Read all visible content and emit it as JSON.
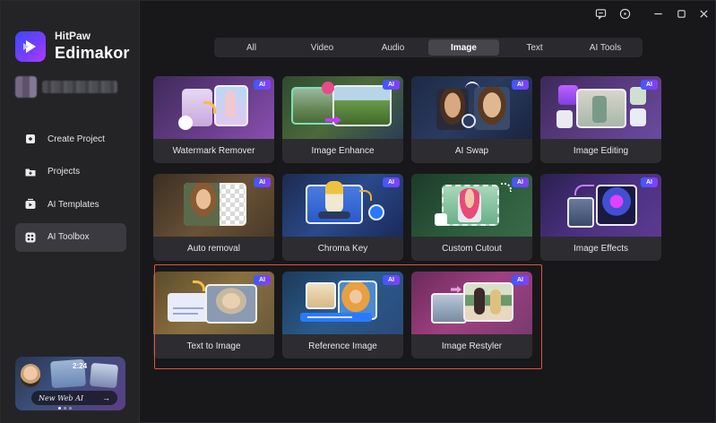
{
  "brand": {
    "company": "HitPaw",
    "product": "Edimakor"
  },
  "sidebar": {
    "items": [
      {
        "label": "Create Project",
        "icon": "create-project-icon",
        "active": false
      },
      {
        "label": "Projects",
        "icon": "projects-icon",
        "active": false
      },
      {
        "label": "AI Templates",
        "icon": "ai-templates-icon",
        "active": false
      },
      {
        "label": "AI Toolbox",
        "icon": "ai-toolbox-icon",
        "active": true
      }
    ],
    "promo": {
      "time": "2:24",
      "text": "New Web AI",
      "arrow": "→"
    }
  },
  "window_controls": [
    "feedback-icon",
    "help-icon",
    "minimize-icon",
    "maximize-icon",
    "close-icon"
  ],
  "tabs": [
    {
      "label": "All",
      "active": false
    },
    {
      "label": "Video",
      "active": false
    },
    {
      "label": "Audio",
      "active": false
    },
    {
      "label": "Image",
      "active": true
    },
    {
      "label": "Text",
      "active": false
    },
    {
      "label": "AI Tools",
      "active": false
    }
  ],
  "badge": "AI",
  "cards": [
    {
      "label": "Watermark Remover"
    },
    {
      "label": "Image Enhance"
    },
    {
      "label": "AI Swap"
    },
    {
      "label": "Image Editing"
    },
    {
      "label": "Auto removal"
    },
    {
      "label": "Chroma Key"
    },
    {
      "label": "Custom Cutout"
    },
    {
      "label": "Image Effects"
    },
    {
      "label": "Text to Image"
    },
    {
      "label": "Reference Image"
    },
    {
      "label": "Image Restyler"
    }
  ],
  "colors": {
    "accent": "#7b3cff",
    "highlight": "#e0533d",
    "active_tab": "#45454b"
  }
}
